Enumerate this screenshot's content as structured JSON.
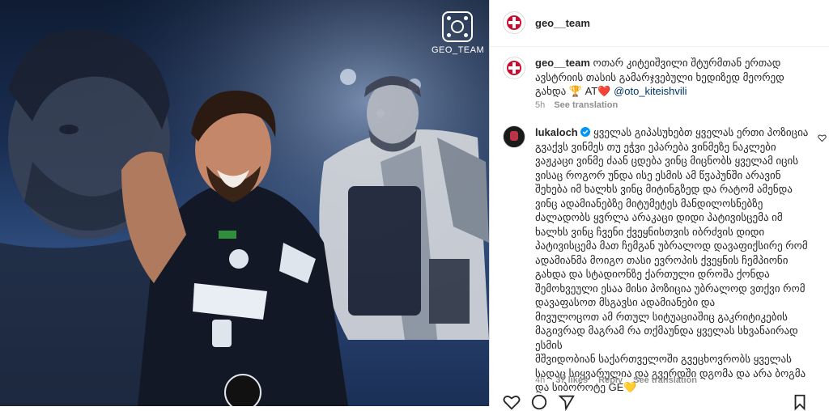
{
  "post": {
    "brand_text": "GEO_TEAM",
    "header_username": "geo__team",
    "header_more": "···"
  },
  "caption": {
    "username": "geo__team",
    "text_lines": [
      "ოთარ კიტეიშვილი შტურმთან ერთად",
      "ავსტრიის თასის გამარჯვებული ხედიზედ მეორედ",
      "გახდა 🏆 AT❤️"
    ],
    "mention": "@oto_kiteishvili",
    "time": "5h",
    "see_translation": "See translation"
  },
  "comment": {
    "username": "lukaloch",
    "verified": true,
    "text_lines": [
      "ყველას გიპასუხებთ ყველას ერთი პოზიცია",
      "გვაქვს ვინმეს თუ ეჭვი ეპარება ვინმეზე ნაკლები",
      "ვაჟკაცი ვინმე ძაან ცდება ვინც მიცნობს ყველამ იცის",
      "ვისაც როგორ უნდა ისე ესმის ამ წჳაპუნში არავინ",
      "შეხება იმ ხალხს ვინც მიტინგზედ და რატომ ამენდა",
      "ვინც ადამიანებზე მიტუმეტეს მანდილოსნებზე",
      "ძალადობს ყვრლა არაკაცი დიდი პატივისცემა იმ",
      "ხალხს ვინც ჩვენი ქვეყნისთვის იბრძვის დიდი",
      "პატივისცემა მათ ჩემგან უბრალოდ დავაფიქსირე რომ",
      "ადამიანმა მოიგო თასი ევროპის ქვეყნის ჩემპიონი",
      "გახდა და სტადიონზე ქართული დროშა ქონდა",
      "შემოხვეული ესაა მისი პოზიცია უბრალოდ ვთქვი რომ",
      "დავაფასოთ მსგავსი ადამიანები და",
      "მივულოცოთ ამ რთულ სიტუაციაშიც გაკრიტიკების",
      "მაგივრად მაგრამ რა თქმაუნდა ყველას სხვანაირად",
      "ესმის",
      "მშვიდობიან საქართველოში გვეცხოვრობს ყველას",
      "სადაც სიყვარულია და გვერდში დგომა და არა ბოგმა",
      "და სიბოროტე GE💛"
    ],
    "time": "4h",
    "likes": "37 likes",
    "reply": "Reply",
    "see_translation": "See translation"
  },
  "colors": {
    "link": "#00376b",
    "meta": "#8e8e8e",
    "text": "#262626",
    "verified": "#0095f6"
  }
}
